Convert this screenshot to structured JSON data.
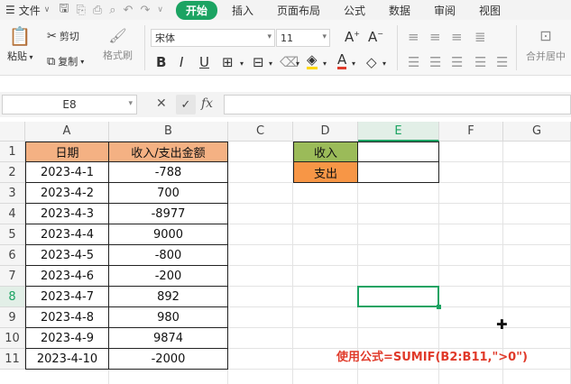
{
  "menubar": {
    "file_label": "文件",
    "tabs": [
      {
        "label": "开始",
        "active": true
      },
      {
        "label": "插入",
        "active": false
      },
      {
        "label": "页面布局",
        "active": false
      },
      {
        "label": "公式",
        "active": false
      },
      {
        "label": "数据",
        "active": false
      },
      {
        "label": "审阅",
        "active": false
      },
      {
        "label": "视图",
        "active": false
      }
    ]
  },
  "ribbon": {
    "paste": "粘贴",
    "cut": "剪切",
    "copy": "复制",
    "format_painter": "格式刷",
    "font_name": "宋体",
    "font_size": "11",
    "merge_center": "合并居中"
  },
  "formula_bar": {
    "name_box": "E8",
    "fx": "fx",
    "formula": ""
  },
  "sheet": {
    "columns": [
      "A",
      "B",
      "C",
      "D",
      "E",
      "F",
      "G"
    ],
    "rows": [
      "1",
      "2",
      "3",
      "4",
      "5",
      "6",
      "7",
      "8",
      "9",
      "10",
      "11"
    ],
    "selected_col": "E",
    "selected_row": "8",
    "table_header": {
      "date": "日期",
      "amount": "收入/支出金额"
    },
    "table_rows": [
      {
        "date": "2023-4-1",
        "amount": "-788"
      },
      {
        "date": "2023-4-2",
        "amount": "700"
      },
      {
        "date": "2023-4-3",
        "amount": "-8977"
      },
      {
        "date": "2023-4-4",
        "amount": "9000"
      },
      {
        "date": "2023-4-5",
        "amount": "-800"
      },
      {
        "date": "2023-4-6",
        "amount": "-200"
      },
      {
        "date": "2023-4-7",
        "amount": "892"
      },
      {
        "date": "2023-4-8",
        "amount": "980"
      },
      {
        "date": "2023-4-9",
        "amount": "9874"
      },
      {
        "date": "2023-4-10",
        "amount": "-2000"
      }
    ],
    "summary": {
      "income_label": "收入",
      "expense_label": "支出",
      "income_value": "",
      "expense_value": ""
    },
    "note": "使用公式=SUMIF(B2:B11,\">0\")"
  },
  "colors": {
    "accent": "#1ba362",
    "header_fill": "#f4b183",
    "income_fill": "#9bbb59",
    "expense_fill": "#f79646",
    "note": "#e03a2a"
  }
}
